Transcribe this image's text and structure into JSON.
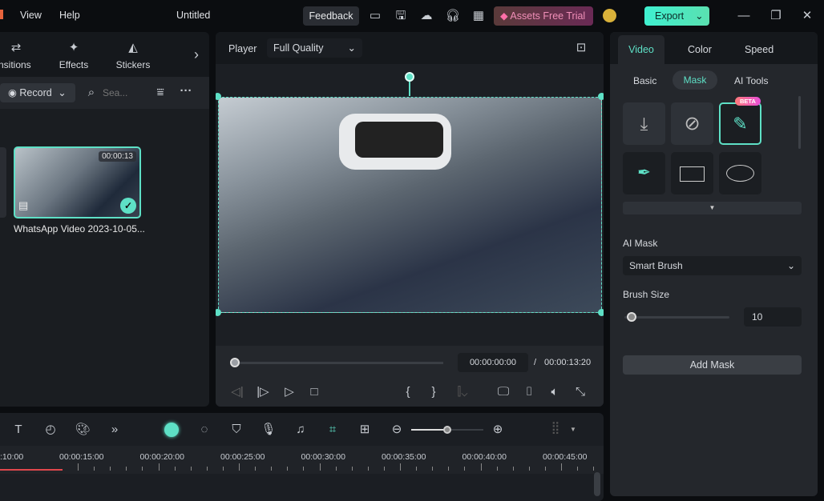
{
  "menu": {
    "view": "View",
    "help": "Help"
  },
  "title": "Untitled",
  "toolbar": {
    "feedback": "Feedback",
    "assets": "Assets Free Trial",
    "export": "Export"
  },
  "left": {
    "tabs": [
      {
        "label": "ansitions",
        "icon": "transitions-icon"
      },
      {
        "label": "Effects",
        "icon": "effects-icon"
      },
      {
        "label": "Stickers",
        "icon": "stickers-icon"
      }
    ],
    "record": "Record",
    "search_placeholder": "Sea...",
    "clip": {
      "duration": "00:00:13",
      "name": "WhatsApp Video 2023-10-05..."
    }
  },
  "player": {
    "label": "Player",
    "quality": "Full Quality",
    "current": "00:00:00:00",
    "sep": "/",
    "total": "00:00:13:20"
  },
  "right": {
    "tabs": [
      "Video",
      "Color",
      "Speed"
    ],
    "subtabs": [
      "Basic",
      "Mask",
      "AI Tools"
    ],
    "beta": "BETA",
    "ai_mask_label": "AI Mask",
    "ai_mask_value": "Smart Brush",
    "brush_size_label": "Brush Size",
    "brush_size": "10",
    "brush_size_fraction": 0.05,
    "add_mask": "Add Mask"
  },
  "timeline": {
    "ticks": [
      ":10:00",
      "00:00:15:00",
      "00:00:20:00",
      "00:00:25:00",
      "00:00:30:00",
      "00:00:35:00",
      "00:00:40:00",
      "00:00:45:00"
    ],
    "zoom_fraction": 0.5
  },
  "colors": {
    "accent": "#5ee0c6",
    "bg": "#1b1e23",
    "playhead": "#e0474c"
  }
}
